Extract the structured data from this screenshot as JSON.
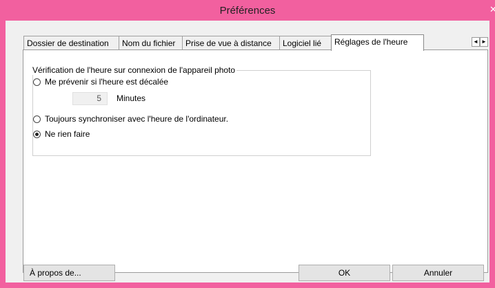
{
  "window": {
    "title": "Préférences"
  },
  "tabs": [
    {
      "label": "Dossier de destination"
    },
    {
      "label": "Nom du fichier"
    },
    {
      "label": "Prise de vue à distance"
    },
    {
      "label": "Logiciel lié"
    },
    {
      "label": "Réglages de l'heure",
      "active": true
    }
  ],
  "time_settings": {
    "group_label": "Vérification de l'heure sur connexion de l'appareil photo",
    "options": [
      {
        "label": "Me prévenir si l'heure est décalée",
        "checked": false
      },
      {
        "label": "Toujours synchroniser avec l'heure de l'ordinateur.",
        "checked": false
      },
      {
        "label": "Ne rien faire",
        "checked": true
      }
    ],
    "minutes_value": "5",
    "minutes_label": "Minutes"
  },
  "footer": {
    "about_label": "À propos de...",
    "ok_label": "OK",
    "cancel_label": "Annuler"
  },
  "icons": {
    "close": "close-icon",
    "tab_prev": "arrow-left-icon",
    "tab_next": "arrow-right-icon"
  },
  "colors": {
    "titlebar": "#f2609f",
    "window_bg": "#f0f0f0",
    "panel_bg": "#ffffff"
  }
}
